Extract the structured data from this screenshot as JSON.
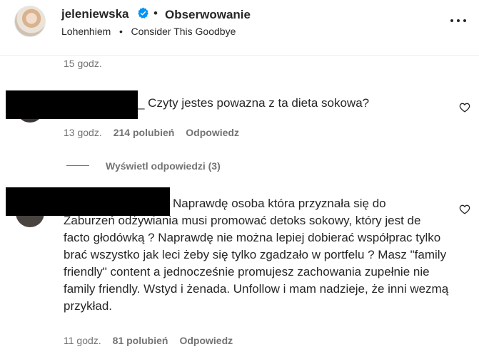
{
  "header": {
    "username": "jeleniewska",
    "separator": "•",
    "follow_status": "Obserwowanie",
    "audio_artist": "Lohenhiem",
    "audio_separator": "•",
    "audio_title": "Consider This Goodbye"
  },
  "top_comment_meta": {
    "time": "15 godz."
  },
  "comments": [
    {
      "text": "_ Czyty jestes powazna z ta dieta sokowa?",
      "time": "13 godz.",
      "likes": "214 polubień",
      "reply_label": "Odpowiedz",
      "view_replies": "Wyświetl odpowiedzi (3)"
    },
    {
      "text_line1": "Naprawdę osoba która przyznała się do",
      "text_rest": "Zaburzeń odżywiania musi promować detoks sokowy, który jest de facto głodówką ? Naprawdę nie można lepiej dobierać współprac tylko brać wszystko jak leci żeby się tylko zgadzało w portfelu ? Masz \"family friendly\" content a jednocześnie promujesz zachowania zupełnie nie family friendly. Wstyd i żenada. Unfollow i mam nadzieje, że inni wezmą przykład.",
      "time": "11 godz.",
      "likes": "81 polubień",
      "reply_label": "Odpowiedz"
    }
  ],
  "colors": {
    "text": "#262626",
    "secondary": "#737373",
    "verified": "#0095f6",
    "redaction": "#000000"
  },
  "icons": [
    "verified-badge-icon",
    "more-options-icon",
    "heart-icon"
  ]
}
